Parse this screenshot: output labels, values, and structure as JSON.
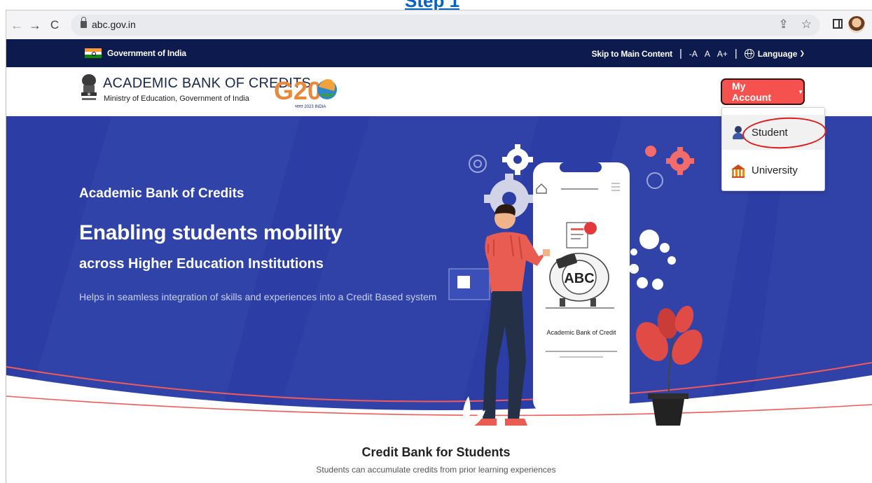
{
  "step_caption": "Step 1",
  "browser": {
    "url": "abc.gov.in",
    "nav": [
      "←",
      "→",
      "C"
    ],
    "actions": [
      "⇪",
      "☆"
    ]
  },
  "gov_strip": {
    "label": "Government of India",
    "skip": "Skip to Main Content",
    "separator": "|",
    "font_sizes": [
      "-A",
      "A",
      "A+"
    ],
    "language": "Language",
    "colors": {
      "background": "#0d1a4e"
    }
  },
  "header": {
    "title": "ACADEMIC BANK OF CREDITS",
    "subtitle": "Ministry of Education, Government of India",
    "g20_text": "G20",
    "g20_caption": "भारत 2023 INDIA",
    "my_account": "My Account",
    "colors": {
      "button": "#f4514f"
    }
  },
  "account_menu": {
    "items": [
      {
        "label": "Student",
        "icon": "student-icon",
        "highlighted": true
      },
      {
        "label": "University",
        "icon": "university-icon"
      }
    ]
  },
  "hero": {
    "kicker": "Academic Bank of Credits",
    "title": "Enabling students mobility",
    "subtitle": "across Higher Education Institutions",
    "text": "Helps in seamless integration of skills and experiences into a Credit Based system",
    "phone_logo": "ABC",
    "phone_caption": "Academic Bank of Credit",
    "colors": {
      "background": "#2c3ea5",
      "accent": "#f15a5a"
    }
  },
  "section": {
    "title": "Credit Bank for Students",
    "text": "Students can accumulate credits from prior learning experiences"
  }
}
